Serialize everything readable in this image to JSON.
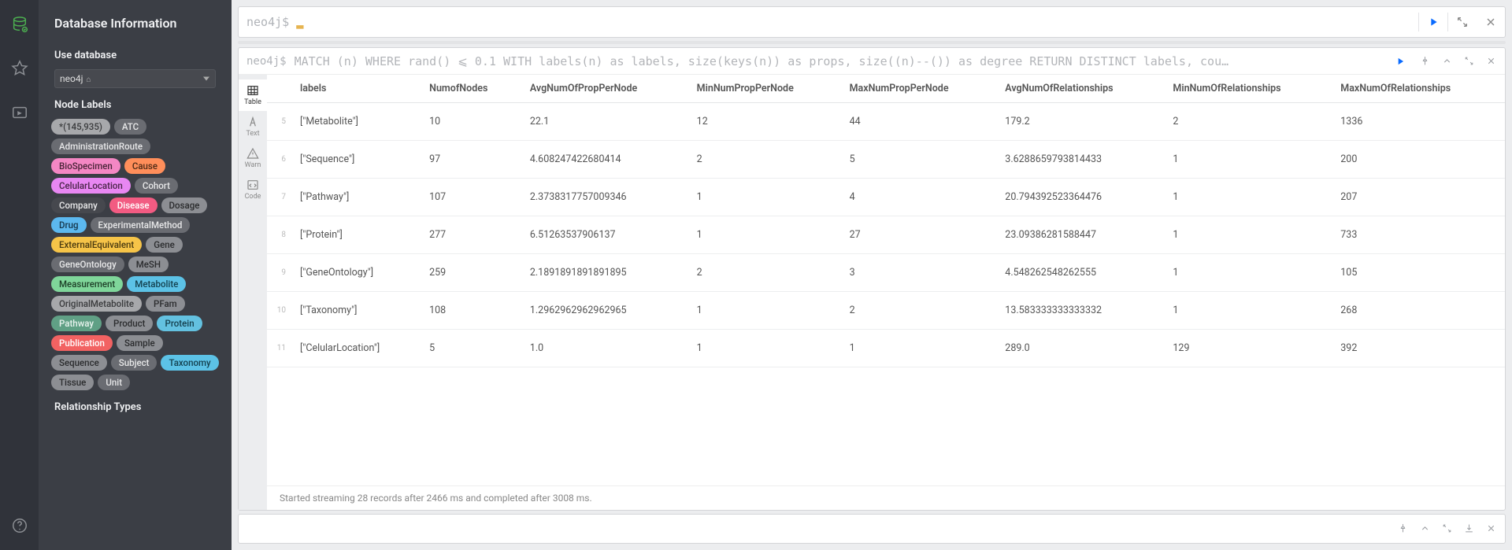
{
  "sidebar": {
    "title": "Database Information",
    "use_db_heading": "Use database",
    "db_select_value": "neo4j",
    "node_labels_heading": "Node Labels",
    "rel_types_heading": "Relationship Types",
    "labels": [
      {
        "text": "*(145,935)",
        "bg": "#a7a8ab",
        "fg": "#3a3b3d"
      },
      {
        "text": "ATC",
        "bg": "#6a6c72",
        "fg": "#e8e8e9"
      },
      {
        "text": "AdministrationRoute",
        "bg": "#6a6c72",
        "fg": "#e8e8e9"
      },
      {
        "text": "BioSpecimen",
        "bg": "#f487c4",
        "fg": "#4a2438"
      },
      {
        "text": "Cause",
        "bg": "#ff8e5a",
        "fg": "#4d2a15"
      },
      {
        "text": "CelularLocation",
        "bg": "#e887f2",
        "fg": "#4a2549"
      },
      {
        "text": "Cohort",
        "bg": "#6a6c72",
        "fg": "#e8e8e9"
      },
      {
        "text": "Company",
        "bg": "#46484e",
        "fg": "#e8e8e9"
      },
      {
        "text": "Disease",
        "bg": "#f25b82",
        "fg": "#ffffff"
      },
      {
        "text": "Dosage",
        "bg": "#8c8e93",
        "fg": "#2b2c2e"
      },
      {
        "text": "Drug",
        "bg": "#5cb8ef",
        "fg": "#15364b"
      },
      {
        "text": "ExperimentalMethod",
        "bg": "#6a6c72",
        "fg": "#e8e8e9"
      },
      {
        "text": "ExternalEquivalent",
        "bg": "#f6c448",
        "fg": "#4a3a10"
      },
      {
        "text": "Gene",
        "bg": "#8c8e93",
        "fg": "#2b2c2e"
      },
      {
        "text": "GeneOntology",
        "bg": "#6a6c72",
        "fg": "#e8e8e9"
      },
      {
        "text": "MeSH",
        "bg": "#8c8e93",
        "fg": "#2b2c2e"
      },
      {
        "text": "Measurement",
        "bg": "#7fd69a",
        "fg": "#1e4028"
      },
      {
        "text": "Metabolite",
        "bg": "#5cc2e6",
        "fg": "#14414f"
      },
      {
        "text": "OriginalMetabolite",
        "bg": "#a7a8ab",
        "fg": "#3a3b3d"
      },
      {
        "text": "PFam",
        "bg": "#8c8e93",
        "fg": "#2b2c2e"
      },
      {
        "text": "Pathway",
        "bg": "#60a085",
        "fg": "#e8f3ee"
      },
      {
        "text": "Product",
        "bg": "#8c8e93",
        "fg": "#2b2c2e"
      },
      {
        "text": "Protein",
        "bg": "#63c1e0",
        "fg": "#143f4c"
      },
      {
        "text": "Publication",
        "bg": "#f26262",
        "fg": "#ffffff"
      },
      {
        "text": "Sample",
        "bg": "#8c8e93",
        "fg": "#2b2c2e"
      },
      {
        "text": "Sequence",
        "bg": "#8c8e93",
        "fg": "#2b2c2e"
      },
      {
        "text": "Subject",
        "bg": "#6a6c72",
        "fg": "#e8e8e9"
      },
      {
        "text": "Taxonomy",
        "bg": "#5cc2e6",
        "fg": "#14414f"
      },
      {
        "text": "Tissue",
        "bg": "#8c8e93",
        "fg": "#2b2c2e"
      },
      {
        "text": "Unit",
        "bg": "#6a6c72",
        "fg": "#e8e8e9"
      }
    ]
  },
  "editor": {
    "prompt": "neo4j$",
    "placeholder": ""
  },
  "card1": {
    "prompt": "neo4j$",
    "query": "MATCH (n) WHERE rand() ⩽ 0.1 WITH labels(n) as labels, size(keys(n)) as props, size((n)--()) as degree RETURN DISTINCT labels, cou…",
    "status": "Started streaming 28 records after 2466 ms and completed after 3008 ms.",
    "view_tabs": {
      "table": "Table",
      "text": "Text",
      "warn": "Warn",
      "code": "Code"
    },
    "columns": [
      "labels",
      "NumofNodes",
      "AvgNumOfPropPerNode",
      "MinNumPropPerNode",
      "MaxNumPropPerNode",
      "AvgNumOfRelationships",
      "MinNumOfRelationships",
      "MaxNumOfRelationships"
    ],
    "rows": [
      {
        "n": "5",
        "cells": [
          "[\"Metabolite\"]",
          "10",
          "22.1",
          "12",
          "44",
          "179.2",
          "2",
          "1336"
        ]
      },
      {
        "n": "6",
        "cells": [
          "[\"Sequence\"]",
          "97",
          "4.608247422680414",
          "2",
          "5",
          "3.6288659793814433",
          "1",
          "200"
        ]
      },
      {
        "n": "7",
        "cells": [
          "[\"Pathway\"]",
          "107",
          "2.3738317757009346",
          "1",
          "4",
          "20.794392523364476",
          "1",
          "207"
        ]
      },
      {
        "n": "8",
        "cells": [
          "[\"Protein\"]",
          "277",
          "6.51263537906137",
          "1",
          "27",
          "23.09386281588447",
          "1",
          "733"
        ]
      },
      {
        "n": "9",
        "cells": [
          "[\"GeneOntology\"]",
          "259",
          "2.1891891891891895",
          "2",
          "3",
          "4.548262548262555",
          "1",
          "105"
        ]
      },
      {
        "n": "10",
        "cells": [
          "[\"Taxonomy\"]",
          "108",
          "1.2962962962962965",
          "1",
          "2",
          "13.583333333333332",
          "1",
          "268"
        ]
      },
      {
        "n": "11",
        "cells": [
          "[\"CelularLocation\"]",
          "5",
          "1.0",
          "1",
          "1",
          "289.0",
          "129",
          "392"
        ]
      }
    ]
  }
}
